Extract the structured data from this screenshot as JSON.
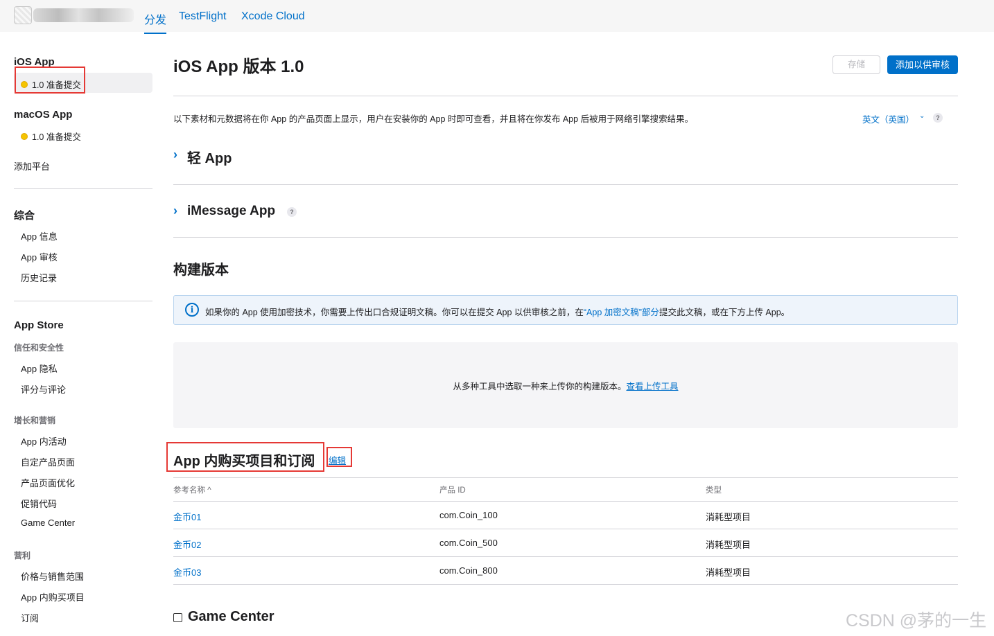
{
  "topbar": {
    "tabs": [
      {
        "label": "分发",
        "active": true
      },
      {
        "label": "TestFlight",
        "active": false
      },
      {
        "label": "Xcode Cloud",
        "active": false
      }
    ]
  },
  "sidebar": {
    "ios_head": "iOS App",
    "ios_version": "1.0 准备提交",
    "macos_head": "macOS App",
    "macos_version": "1.0 准备提交",
    "add_platform": "添加平台",
    "general_head": "综合",
    "general_items": [
      "App 信息",
      "App 审核",
      "历史记录"
    ],
    "appstore_head": "App Store",
    "trust_group": "信任和安全性",
    "trust_items": [
      "App 隐私",
      "评分与评论"
    ],
    "growth_group": "增长和营销",
    "growth_items": [
      "App 内活动",
      "自定产品页面",
      "产品页面优化",
      "促销代码",
      "Game Center"
    ],
    "monetize_group": "营利",
    "monetize_items": [
      "价格与销售范围",
      "App 内购买项目",
      "订阅"
    ]
  },
  "main": {
    "title": "iOS App 版本 1.0",
    "save_label": "存储",
    "submit_label": "添加以供审核",
    "description": "以下素材和元数据将在你 App 的产品页面上显示，用户在安装你的 App 时即可查看，并且将在你发布 App 后被用于网络引擎搜索结果。",
    "language": "英文（英国）",
    "help_mark": "?",
    "clip_title": "轻 App",
    "imessage_title": "iMessage App",
    "build_title": "构建版本",
    "info_pre": "如果你的 App 使用加密技术，你需要上传出口合规证明文稿。你可以在提交 App 以供审核之前，在",
    "info_link": "“App 加密文稿”部分",
    "info_post": "提交此文稿，或在下方上传 App。",
    "upload_text": "从多种工具中选取一种来上传你的构建版本。",
    "upload_link": "查看上传工具",
    "iap_title": "App 内购买项目和订阅",
    "iap_edit": "编辑",
    "table": {
      "headers": [
        "参考名称 ^",
        "产品 ID",
        "类型"
      ],
      "rows": [
        [
          "金币01",
          "com.Coin_100",
          "消耗型项目"
        ],
        [
          "金币02",
          "com.Coin_500",
          "消耗型项目"
        ],
        [
          "金币03",
          "com.Coin_800",
          "消耗型项目"
        ]
      ]
    },
    "game_center_title": "Game Center"
  },
  "watermark": "CSDN @茅的一生",
  "colors": {
    "accent": "#0070c9",
    "highlight": "#e53935",
    "status_dot": "#f5c400"
  }
}
